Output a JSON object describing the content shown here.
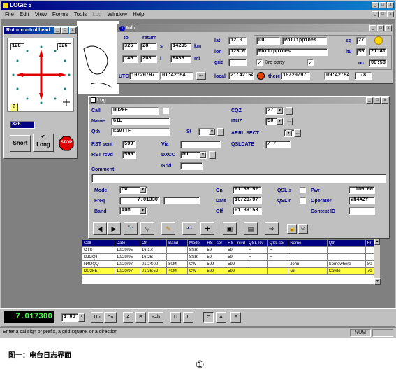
{
  "app": {
    "title": "LOGic 5"
  },
  "menu": [
    "File",
    "Edit",
    "View",
    "Forms",
    "Tools",
    "Log",
    "Window",
    "Help"
  ],
  "rotor": {
    "title": "Rotor control head",
    "left_bearing": "128",
    "right_bearing": "326",
    "input_value": "326",
    "short_label": "Short",
    "long_label": "Long",
    "stop_label": "STOP",
    "help_label": "?"
  },
  "info": {
    "title": "Info",
    "to_label": "to",
    "return_label": "return",
    "deg_to": "326",
    "deg_return": "28",
    "s_label": "s",
    "s_value": "14295",
    "km_label": "km",
    "km_to": "146",
    "km_return": "208",
    "l_label": "l",
    "l_value": "8883",
    "mi_label": "mi",
    "lat_label": "lat",
    "lat_value": "12.0",
    "lon_label": "lon",
    "lon_value": "123.0",
    "grid_label": "grid",
    "grid_value": "",
    "utc_label": "UTC",
    "utc_date": "10/20/97",
    "utc_time": "01:42:54",
    "local_label": "local",
    "local_time": "21:42:54",
    "there_label": "there",
    "there_date": "10/20/97",
    "there_time": "09:42:54",
    "there_offset": "-8",
    "prefix": "DU",
    "country_top": "Philippines",
    "sq_label": "sq",
    "sq_value": "27",
    "country": "Philippines",
    "itu_label": "itu",
    "itu_value": "50",
    "itu_time": "21:41",
    "third_party_label": "3rd party",
    "oc_label": "oc",
    "oc_time": "09:58"
  },
  "log": {
    "title": "Log",
    "call_label": "Call",
    "call_value": "DU2FE",
    "name_label": "Name",
    "name_value": "GIL",
    "qth_label": "Qth",
    "qth_value": "CAVITE",
    "st_label": "St",
    "rst_sent_label": "RST sent",
    "rst_sent_value": "599",
    "rst_rcvd_label": "RST rcvd",
    "rst_rcvd_value": "599",
    "via_label": "Via",
    "dxcc_label": "DXCC",
    "dxcc_value": "DU",
    "grid_label": "Grid",
    "cqz_label": "CQZ",
    "cqz_value": "27",
    "ituz_label": "ITUZ",
    "ituz_value": "50",
    "arrl_label": "ARRL SECT",
    "qsldate_label": "QSLDATE",
    "qsldate_value": " /  /",
    "comment_label": "Comment",
    "mode_label": "Mode",
    "mode_value": "CW",
    "freq_label": "Freq",
    "freq_value": "7.01330",
    "band_label": "Band",
    "band_value": "40M",
    "on_label": "On",
    "on_value": "01:36:52",
    "date_label": "Date",
    "date_value": "10/20/97",
    "off_label": "Off",
    "off_value": "01:39:53",
    "qsls_label": "QSL s",
    "qslr_label": "QSL r",
    "pwr_label": "Pwr",
    "pwr_value": "100.00",
    "operator_label": "Operator",
    "operator_value": "WN4AZY",
    "contest_label": "Contest ID"
  },
  "table": {
    "headers": [
      "Call",
      "Date",
      "On",
      "Band",
      "Mode",
      "RST ser",
      "RST rcvd",
      "QSL rcv",
      "QSL ser",
      "Name",
      "Qth",
      "Fr"
    ],
    "rows": [
      [
        "OTST",
        "10/29/95",
        "16:17:",
        "",
        "SSB",
        "59",
        "59",
        "F",
        "F",
        "",
        "",
        ""
      ],
      [
        "DJGQT",
        "10/29/95",
        "16:26:",
        "",
        "SSB",
        "59",
        "59",
        "F",
        "F",
        "",
        "",
        ""
      ],
      [
        "N4QQQ",
        "10/20/97",
        "01:24:00",
        "80M",
        "CW",
        "599",
        "599",
        "",
        "",
        "John",
        "Somewhere",
        "80"
      ],
      [
        "DU2FE",
        "10/20/97",
        "01:36:52",
        "40M",
        "CW",
        "599",
        "599",
        "",
        "",
        "Gil",
        "Cavite",
        "70"
      ]
    ]
  },
  "bottombar": {
    "freq": "7.017300",
    "step": "1.00",
    "buttons": [
      "Up",
      "Dn",
      "A",
      "B",
      "a=b",
      "U",
      "L",
      "C",
      "A",
      "F"
    ]
  },
  "status": {
    "text": "Enter a callsign or prefix, a grid square, or a direction",
    "num": "NUM"
  },
  "caption": {
    "text": "图一：电台日志界面",
    "mark": "①"
  }
}
